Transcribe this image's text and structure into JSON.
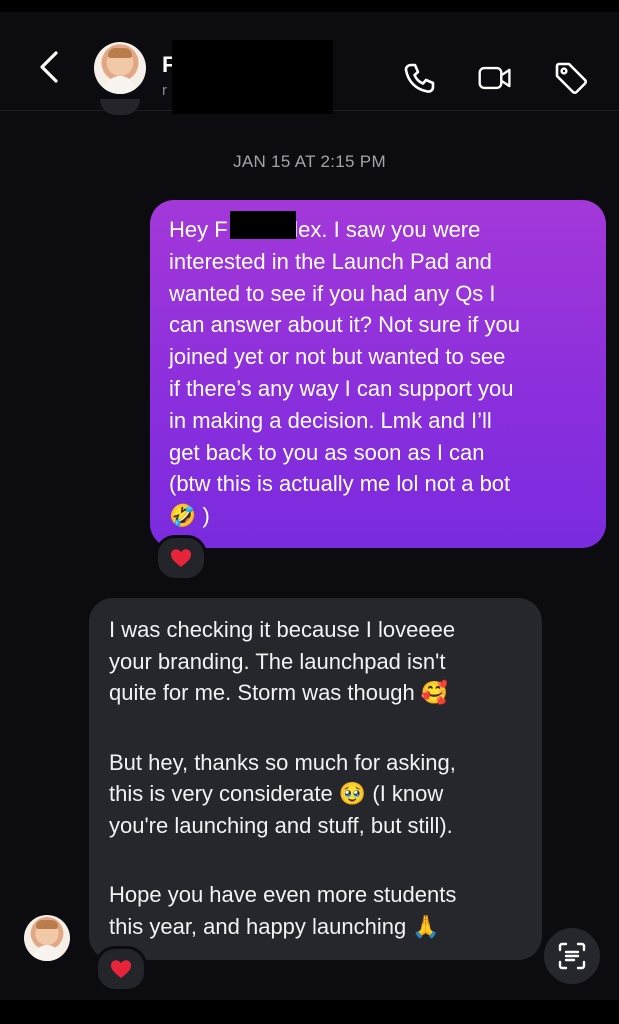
{
  "header": {
    "contact_initial": "F",
    "sub_initial": "r",
    "icons": [
      "back-chevron-icon",
      "phone-icon",
      "video-call-icon",
      "tag-icon"
    ]
  },
  "timestamp": "JAN 15 AT 2:15 PM",
  "outgoing": {
    "text": "Hey F               ! It’s Alex. I saw you were\ninterested in the Launch Pad and\nwanted to see if you had any Qs I\ncan answer about it? Not sure if you\njoined yet or not but wanted to see\nif there’s any way I can support you\nin making a decision. Lmk and I’ll\nget back to you as soon as I can\n(btw this is actually me lol not a bot\n🤣 )",
    "reaction": "❤️"
  },
  "incoming": {
    "paragraphs": [
      "I was checking it because I loveeee\nyour branding. The launchpad isn't\nquite for me. Storm was though 🥰",
      "But hey, thanks so much for asking,\nthis is very considerate 🥹  (I know\nyou're launching and stuff, but still).",
      "Hope you have even more students\nthis year, and happy launching 🙏"
    ],
    "reaction": "❤️"
  },
  "colors": {
    "background": "#0c0c10",
    "outgoing_bubble": "#8b2fdc",
    "incoming_bubble": "#26272d",
    "reaction_heart": "#e8243b"
  }
}
